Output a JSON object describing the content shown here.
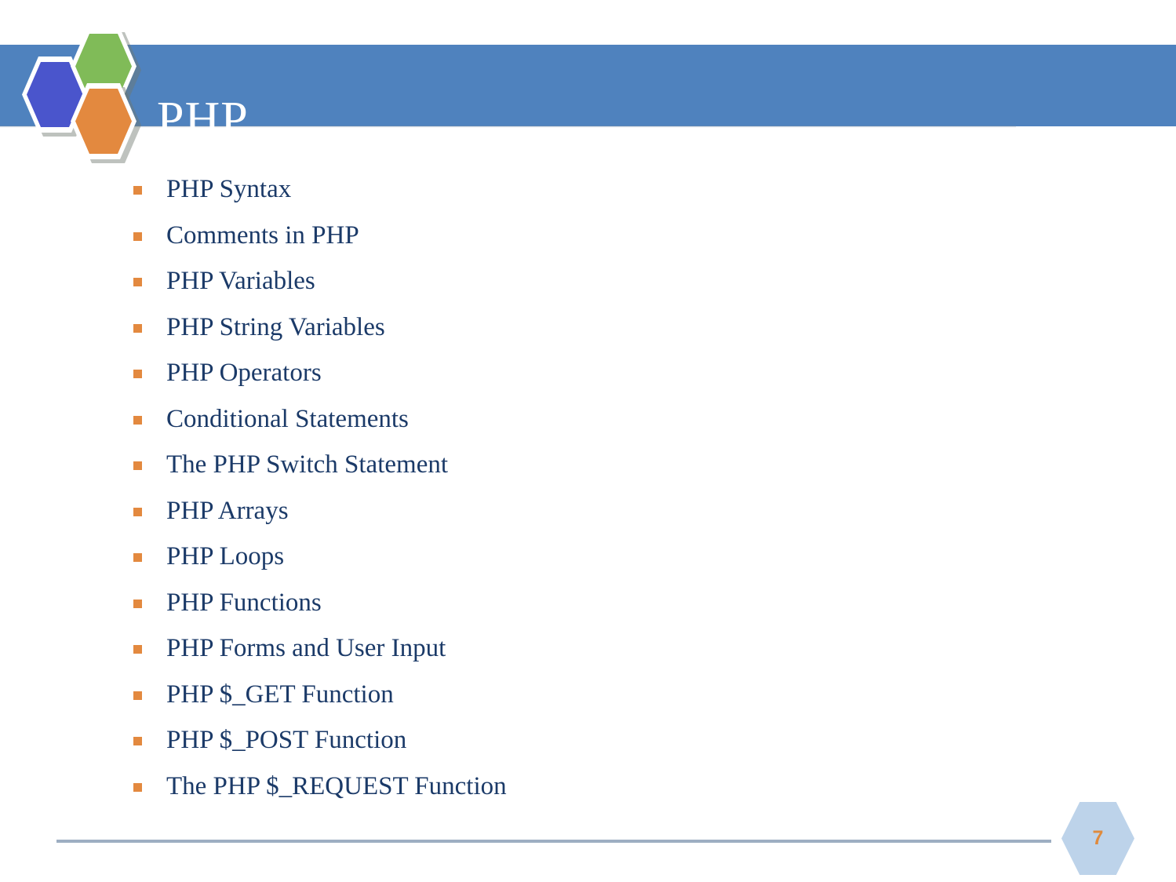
{
  "slide": {
    "title": "PHP",
    "page_number": "7",
    "colors": {
      "banner_blue": "#4F82BE",
      "hex_blue": "#4A55CC",
      "hex_green": "#80BB58",
      "hex_orange": "#E3893F",
      "bullet_orange": "#E3893F",
      "body_navy": "#1B3A68",
      "footer_hex": "#BDD3EA",
      "footer_rule": "#9DAEC2",
      "page_number_orange": "#E08A3C",
      "background": "#FFFFFF"
    }
  },
  "logo": {
    "hexagons": [
      {
        "name": "hex-blue-icon",
        "color": "#4A55CC"
      },
      {
        "name": "hex-green-icon",
        "color": "#80BB58"
      },
      {
        "name": "hex-orange-icon",
        "color": "#E3893F"
      }
    ]
  },
  "content": {
    "bullets": [
      {
        "label": "PHP Syntax"
      },
      {
        "label": "Comments in PHP"
      },
      {
        "label": "PHP Variables"
      },
      {
        "label": "PHP String Variables"
      },
      {
        "label": "PHP Operators"
      },
      {
        "label": "Conditional Statements"
      },
      {
        "label": "The PHP Switch Statement"
      },
      {
        "label": "PHP Arrays"
      },
      {
        "label": "PHP Loops"
      },
      {
        "label": "PHP Functions"
      },
      {
        "label": "PHP Forms and User Input"
      },
      {
        "label": "PHP $_GET Function"
      },
      {
        "label": "PHP $_POST Function"
      },
      {
        "label": "The PHP $_REQUEST Function"
      }
    ]
  }
}
